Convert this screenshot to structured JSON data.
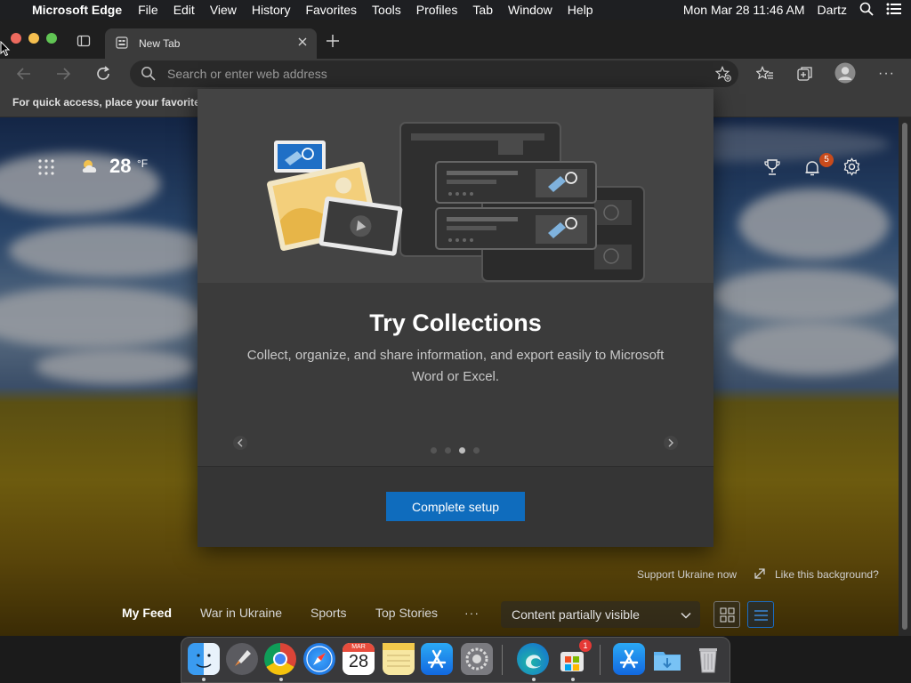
{
  "menubar": {
    "app_name": "Microsoft Edge",
    "items": [
      "File",
      "Edit",
      "View",
      "History",
      "Favorites",
      "Tools",
      "Profiles",
      "Tab",
      "Window",
      "Help"
    ],
    "datetime": "Mon Mar 28  11:46 AM",
    "user": "Dartz"
  },
  "browser": {
    "tab_title": "New Tab",
    "address_placeholder": "Search or enter web address",
    "favorites_hint": "For quick access, place your favorite"
  },
  "newtab": {
    "temperature": "28",
    "temp_unit": "°F",
    "notification_count": "5",
    "support_link": "Support Ukraine now",
    "background_link": "Like this background?",
    "feed_tabs": [
      "My Feed",
      "War in Ukraine",
      "Sports",
      "Top Stories"
    ],
    "more": "···",
    "content_visibility": "Content partially visible"
  },
  "modal": {
    "title": "Try Collections",
    "description": "Collect, organize, and share information, and export easily to Microsoft Word or Excel.",
    "button": "Complete setup",
    "carousel_total": 4,
    "carousel_active": 3
  },
  "dock": {
    "calendar_month": "MAR",
    "calendar_day": "28",
    "appstore_badge": "1"
  },
  "colors": {
    "accent": "#0f6cbd",
    "notification_badge": "#c84b1c"
  }
}
